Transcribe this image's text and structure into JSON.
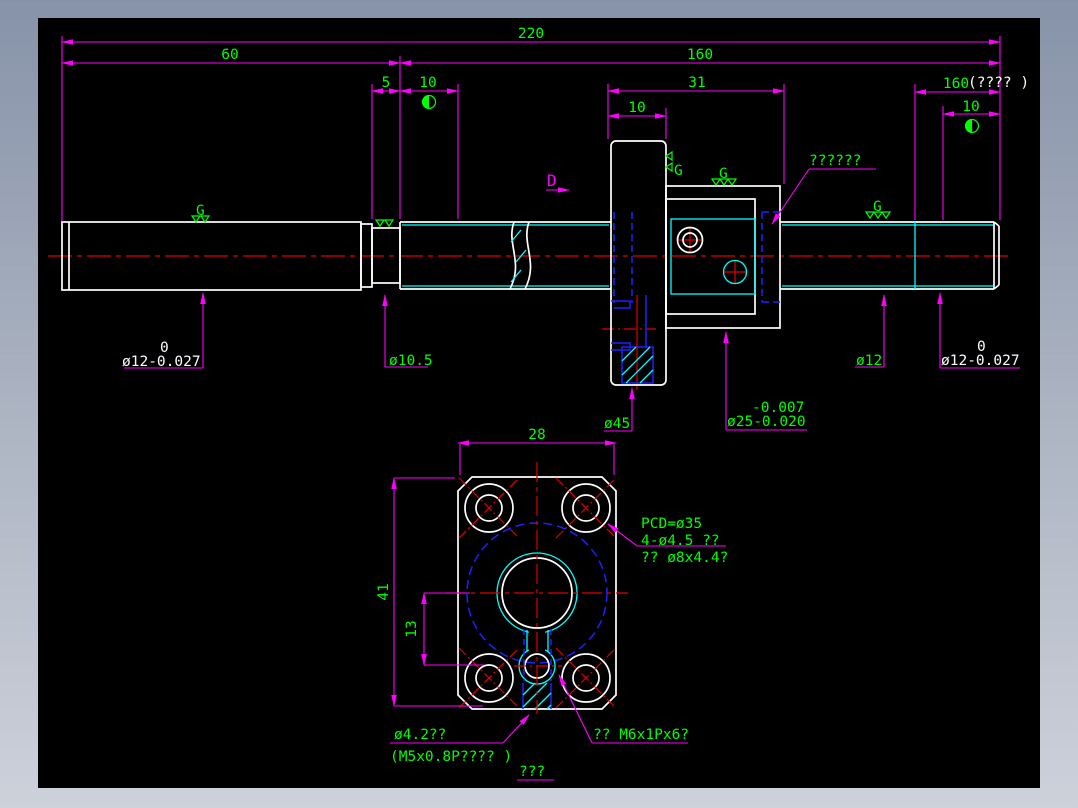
{
  "colors": {
    "canvas": "#000000",
    "frame_top": "#8793a9",
    "frame_bottom": "#cdd1da",
    "dimension_lines": "#ff00ff",
    "annotation_text": "#00ff00",
    "geometry": "#ffffff",
    "auxiliary": "#00ffff",
    "hidden_lines": "#2020ff",
    "centerlines": "#e00000",
    "tolerance_text": "#ffffff"
  },
  "dims": {
    "overall": "220",
    "left_journal": "60",
    "right_section": "160",
    "groove": "5",
    "left_land": "10",
    "nut_width": "31",
    "flange_width": "10",
    "thread_length": "160",
    "thread_note": "(???? )",
    "end_land": "10",
    "flange_od": "ø45",
    "nut_od_upper": "-0.007",
    "nut_od": "ø25-0.020",
    "left_dia_upper": "0",
    "left_dia": "ø12-0.027",
    "neck_dia": "ø10.5",
    "right_dia": "ø12",
    "right_end_upper": "0",
    "right_end_dia": "ø12-0.027"
  },
  "notes": {
    "nut_note": "??????",
    "view_label": "D",
    "finish_letter": "G"
  },
  "front": {
    "width": "28",
    "height": "41",
    "hole_offset": "13",
    "pcd": "PCD=ø35",
    "bolt_holes": "4-ø4.5 ??",
    "counterbore": "?? ø8x4.4?",
    "tap_dia": "ø4.2??",
    "tap_spec": "(M5x0.8P???? )",
    "side_tap": "?? M6x1Px6?",
    "section_label": "???"
  }
}
